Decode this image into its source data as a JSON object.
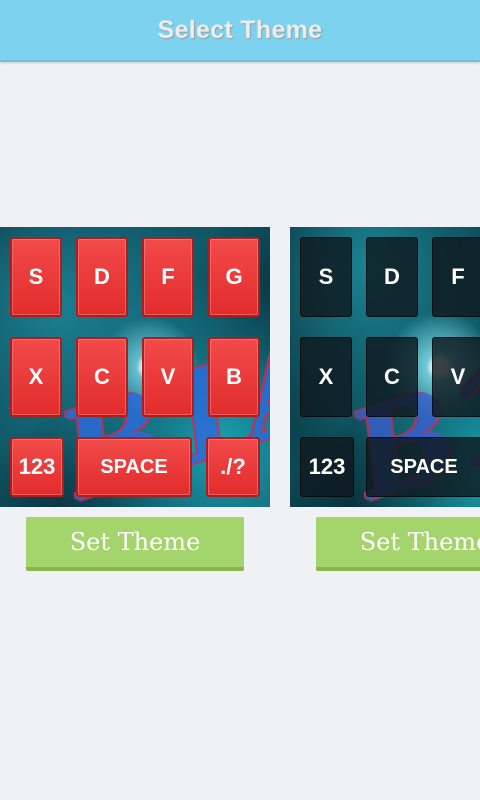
{
  "header": {
    "title": "Select Theme"
  },
  "themes": [
    {
      "style": "red",
      "watermark": "B1A",
      "keys": [
        "S",
        "D",
        "F",
        "G",
        "X",
        "C",
        "V",
        "B",
        "123",
        "SPACE",
        "./?"
      ],
      "button_label": "Set Theme"
    },
    {
      "style": "dark",
      "watermark": "B1A",
      "keys": [
        "S",
        "D",
        "F",
        "X",
        "C",
        "V",
        "123",
        "SPACE"
      ],
      "button_label": "Set Theme"
    }
  ],
  "colors": {
    "header_bg": "#7dd3ef",
    "page_bg": "#f0f1f5",
    "button_bg": "#a4d46c",
    "red_key": "#ef3b3b",
    "dark_key": "#11191e"
  }
}
